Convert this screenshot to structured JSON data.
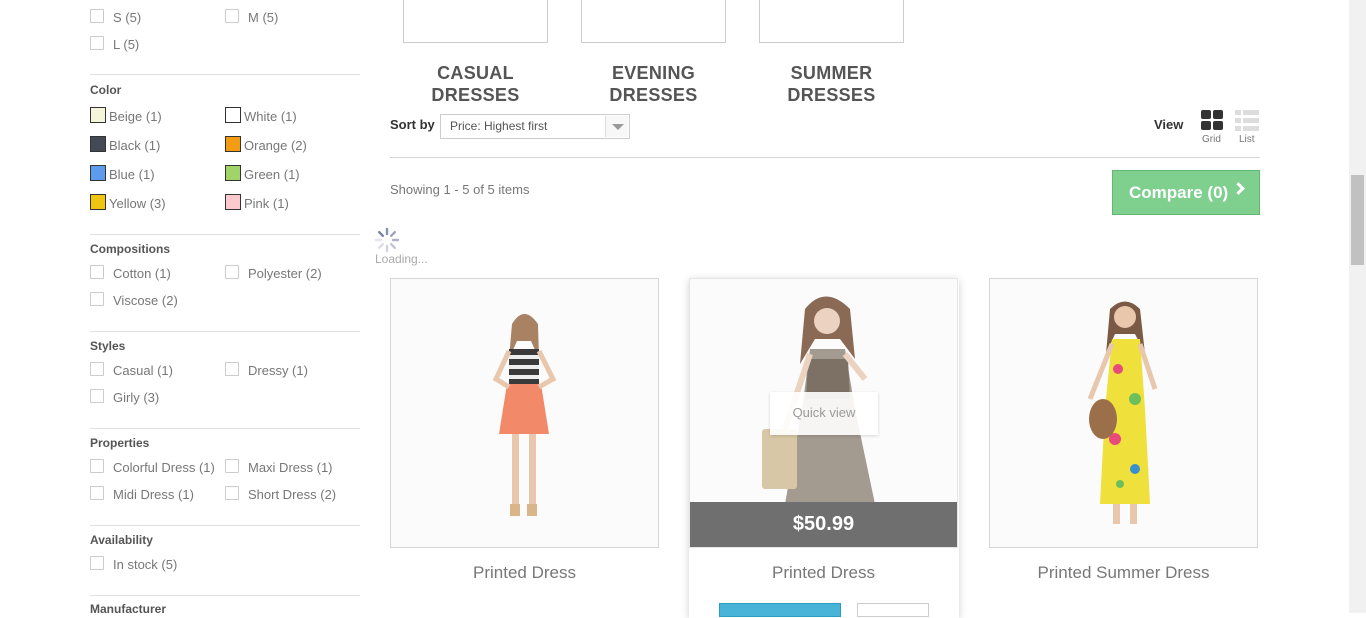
{
  "filters": {
    "size": {
      "options": [
        {
          "label": "S (5)"
        },
        {
          "label": "M (5)"
        },
        {
          "label": "L (5)"
        }
      ]
    },
    "color": {
      "title": "Color",
      "options": [
        {
          "label": "Beige (1)",
          "color": "#f5f5dc"
        },
        {
          "label": "White (1)",
          "color": "#ffffff"
        },
        {
          "label": "Black (1)",
          "color": "#434a54"
        },
        {
          "label": "Orange (2)",
          "color": "#f39c11"
        },
        {
          "label": "Blue (1)",
          "color": "#5d9cec"
        },
        {
          "label": "Green (1)",
          "color": "#a0d468"
        },
        {
          "label": "Yellow (3)",
          "color": "#f1c40f"
        },
        {
          "label": "Pink (1)",
          "color": "#fccacd"
        }
      ]
    },
    "compositions": {
      "title": "Compositions",
      "options": [
        {
          "label": "Cotton (1)"
        },
        {
          "label": "Polyester (2)"
        },
        {
          "label": "Viscose (2)"
        }
      ]
    },
    "styles": {
      "title": "Styles",
      "options": [
        {
          "label": "Casual (1)"
        },
        {
          "label": "Dressy (1)"
        },
        {
          "label": "Girly (3)"
        }
      ]
    },
    "properties": {
      "title": "Properties",
      "options": [
        {
          "label": "Colorful Dress (1)"
        },
        {
          "label": "Maxi Dress (1)"
        },
        {
          "label": "Midi Dress (1)"
        },
        {
          "label": "Short Dress (2)"
        }
      ]
    },
    "availability": {
      "title": "Availability",
      "options": [
        {
          "label": "In stock (5)"
        }
      ]
    },
    "manufacturer": {
      "title": "Manufacturer"
    }
  },
  "subcategories": [
    {
      "line1": "CASUAL",
      "line2": "DRESSES"
    },
    {
      "line1": "EVENING",
      "line2": "DRESSES"
    },
    {
      "line1": "SUMMER",
      "line2": "DRESSES"
    }
  ],
  "toolbar": {
    "sort_label": "Sort by",
    "sort_value": "Price: Highest first",
    "view_label": "View",
    "grid_label": "Grid",
    "list_label": "List"
  },
  "showing_text": "Showing 1 - 5 of 5 items",
  "compare_label": "Compare (0)",
  "loading_text": "Loading...",
  "products": [
    {
      "name": "Printed Dress"
    },
    {
      "name": "Printed Dress",
      "price": "$50.99",
      "quick_view": "Quick view"
    },
    {
      "name": "Printed Summer Dress"
    }
  ]
}
